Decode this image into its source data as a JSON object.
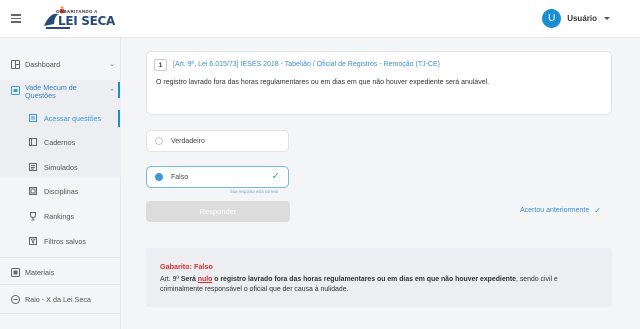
{
  "header": {
    "logo_top": "GABARITANDO A",
    "logo_main": "LEI SECA",
    "user_initial": "U",
    "user_name": "Usuário"
  },
  "sidebar": {
    "dashboard": "Dashboard",
    "vade_mecum_1": "Vade Mecum de",
    "vade_mecum_2": "Questões",
    "sub": {
      "acessar": "Acessar questões",
      "cadernos": "Cadernos",
      "simulados": "Simulados",
      "disciplinas": "Disciplinas",
      "rankings": "Rankings",
      "filtros": "Filtros salvos"
    },
    "materiais": "Materiais",
    "raio_x": "Raio - X da Lei Seca"
  },
  "question": {
    "number": "1",
    "meta": "[Art. 9º, Lei 6.015/73] IESES 2018 - Tabelião / Oficial de Registros - Remoção (TJ-CE)",
    "text": "O registro lavrado fora das horas regulamentares ou em dias em que não houver expediente será anulável."
  },
  "options": [
    {
      "label": "Verdadeiro",
      "selected": false
    },
    {
      "label": "Falso",
      "selected": true
    }
  ],
  "answer_note": "Sua resposta está correta",
  "respond_button": "Responder",
  "previous_status": "Acertou anteriormente",
  "gabarito": {
    "title": "Gabarito: Falso",
    "art": "Art. 9º",
    "sera": "Será",
    "nulo": "nulo",
    "middle": "o registro lavrado fora das horas regulamentares ou em dias em que não houver expediente",
    "end": ", sendo civil e criminalmente responsável o oficial que der causa à nulidade."
  },
  "colors": {
    "accent": "#1a8fd0",
    "link": "#3b8fd0",
    "error": "#d32f2f"
  }
}
